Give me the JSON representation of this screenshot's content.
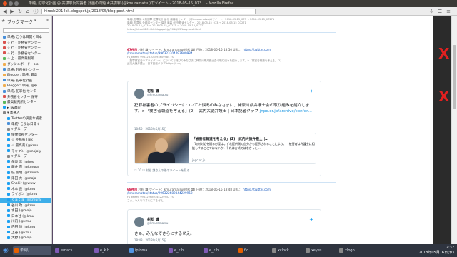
{
  "window": {
    "title": "単純\\ 犯罪化計画 @ 共謀罪反対論者 計画の問題 #共謀罪 (@kmuramatsu)のツイート - 2018-05-15_073… - Mozilla Firefox"
  },
  "nav": {
    "url": "hiroshi2014kk.blogspot.jp/2018/05/blog-post.html"
  },
  "sidebar": {
    "title": "ブックマーク",
    "items": [
      {
        "label": "単純\\ こうは日開く日本",
        "icon_color": "#4a90d9",
        "selected": false
      },
      {
        "label": "☆ 行 - 外務省センター",
        "icon_color": "#d9534f",
        "selected": false
      },
      {
        "label": "☆ 行 - 外務省センター",
        "icon_color": "#d9534f",
        "selected": false
      },
      {
        "label": "☆ 行 - 外務省センター",
        "icon_color": "#d9534f",
        "selected": false
      },
      {
        "label": "☆ 上 - 最高裁判所",
        "icon_color": "#5cb85c",
        "selected": false
      },
      {
        "label": "ダッシュボード - blo",
        "icon_color": "#f0ad4e",
        "selected": false
      },
      {
        "label": "単純\\ 外務省センター",
        "icon_color": "#4a90d9",
        "selected": false
      },
      {
        "label": "Blogger: 単純\\ 最高",
        "icon_color": "#f0ad4e",
        "selected": false
      },
      {
        "label": "単純\\ 犯罪化計画",
        "icon_color": "#4a90d9",
        "selected": false
      },
      {
        "label": "Blogger: 単純\\ 犯罪",
        "icon_color": "#f0ad4e",
        "selected": false
      },
      {
        "label": "単純\\ 犯罪化 センター",
        "icon_color": "#4a90d9",
        "selected": false
      },
      {
        "label": "外務省センター 保守",
        "icon_color": "#d9534f",
        "selected": false
      },
      {
        "label": "最高裁判所センター",
        "icon_color": "#5cb85c",
        "selected": false
      },
      {
        "label": "▸ Twitter",
        "icon_color": "#1da1f2",
        "selected": false
      },
      {
        "label": "▾ 本通人",
        "icon_color": "#888888",
        "selected": false
      },
      {
        "label": "Twitterの調査な検索",
        "icon_color": "#1da1f2",
        "selected": false
      },
      {
        "label": "単純\\ こうは日開く",
        "icon_color": "#4a90d9",
        "selected": false
      },
      {
        "label": "▾ グループ",
        "icon_color": "#888888",
        "selected": false
      },
      {
        "label": "保健福祉センター",
        "icon_color": "#1da1f2",
        "selected": false
      },
      {
        "label": "☆ 外務省 (@k",
        "icon_color": "#1da1f2",
        "selected": false
      },
      {
        "label": "☆ 最高裁 (@kmu",
        "icon_color": "#1da1f2",
        "selected": false
      },
      {
        "label": "モキケン (@mojoly",
        "icon_color": "#1da1f2",
        "selected": false
      },
      {
        "label": "▾ グループ",
        "icon_color": "#888888",
        "selected": false
      },
      {
        "label": "保坂 三 (@hos",
        "icon_color": "#1da1f2",
        "selected": false
      },
      {
        "label": "藤井 京 (@kmura",
        "icon_color": "#1da1f2",
        "selected": false
      },
      {
        "label": "低 聡明 (@kmura",
        "icon_color": "#1da1f2",
        "selected": false
      },
      {
        "label": "浮田 大 (@mojo",
        "icon_color": "#1da1f2",
        "selected": false
      },
      {
        "label": "Shokir (@www",
        "icon_color": "#1da1f2",
        "selected": false
      },
      {
        "label": "木本 良 (@kmu",
        "icon_color": "#1da1f2",
        "selected": false
      },
      {
        "label": "ライオン (@kmu",
        "icon_color": "#1da1f2",
        "selected": false
      },
      {
        "label": "くまくま (@kmura",
        "icon_color": "#1da1f2",
        "selected": true
      },
      {
        "label": "谷川 政 (@kmu",
        "icon_color": "#1da1f2",
        "selected": false
      },
      {
        "label": "水田 (@mojo",
        "icon_color": "#1da1f2",
        "selected": false
      },
      {
        "label": "日本社 (@kmu",
        "icon_color": "#1da1f2",
        "selected": false
      },
      {
        "label": "川内 (@kmu",
        "icon_color": "#1da1f2",
        "selected": false
      },
      {
        "label": "内田 悟 (@kmu",
        "icon_color": "#1da1f2",
        "selected": false
      },
      {
        "label": "上谷 (@kmu",
        "icon_color": "#1da1f2",
        "selected": false
      },
      {
        "label": "大野 (@mojo",
        "icon_color": "#1da1f2",
        "selected": false
      }
    ]
  },
  "content": {
    "top_lines": [
      "単純\\ 犯罪化 #共謀罪 犯罪化計画 @ 最高裁センター (@kmuramatsu)のツイート - 2018-05-15_073 → 2018-05-15_07271",
      "単純\\ 犯罪化 外務省センター 保守 最高 @ 外務省センター - 2018-05-15_073 → 2018-05-15_07271",
      "2018-05-15_073 → 2018-05-15_07271 → 2018-05-15_07271",
      "https://hiroshi2014kk.blogspot.jp/2018/05/blog-post.html"
    ],
    "entries": [
      {
        "number": "67件目",
        "head": "村松 謙 ツイート：kmuramatsu(村松 謙) 日時：2018-05-15 18:50 URL：",
        "link": "https://twitter.com",
        "link2": "/kmuramatsu/status/996323704493609984",
        "meta": [
          "Fs_tweet: 996323704493609984 FS",
          "〔犯罪被害者のプライバシー〕についてお詫びのみなさまに神奈川県弁護士会の取り組みを紹介します。>「被害者報道を考える」(2)",
          "武内大徳弁護士 | 日本記者クラブ https://t.co/..."
        ],
        "tweet": {
          "name": "村松 謙",
          "handle": "@kmuramatsu",
          "text": "犯罪被害者のプライバシーについてお悩みのみなさまに、神奈川県弁護士会の取り組みを紹介します。>「被害者報道を考える」(2)　武内大徳弁護士 | 日本記者クラブ",
          "url": "jnpc.or.jp/archive/confer…",
          "date": "18:50 - 2018年5月15日",
          "card_title": "「被害者報道を考える」(2)　武内大徳弁護士 |…",
          "card_desc": "「取材対応を通る必要はいずれ提供側の自分から提示されることにより、　被害者は弁護士に相談しすることではないか。それは方式ではなかった…",
          "card_domain": "jnpc.or.jp",
          "footer": "♡ 10   ☑ 村松 謙さんの他のツイートを見る"
        }
      },
      {
        "number": "68件目",
        "head": "村松 謙 ツイート：kmuramatsu(村松 謙) 日時：2018-05-15 18:48 URL：",
        "link": "https://twitter.com",
        "link2": "/kmuramatsu/status/996322689344229952",
        "meta": [
          "Fs_tweet: 996322689344229952 FS",
          "さぁ、みんなでさらにするぜえ。"
        ],
        "tweet": {
          "name": "村松 謙",
          "handle": "@kmuramatsu",
          "text": "さぁ、みんなでさらにするぜえ。",
          "date": "18:48 - 2018年5月15日"
        }
      }
    ]
  },
  "taskbar": {
    "items": [
      {
        "label": "単純\\",
        "icon_color": "#e66000"
      },
      {
        "label": "emacs",
        "icon_color": "#7f5ab6"
      },
      {
        "label": "e_k.h..",
        "icon_color": "#7f5ab6"
      },
      {
        "label": "ipfoma..",
        "icon_color": "#5294e2"
      },
      {
        "label": "e_k.h..",
        "icon_color": "#7f5ab6"
      },
      {
        "label": "e_k.h..",
        "icon_color": "#7f5ab6"
      },
      {
        "label": "flc",
        "icon_color": "#e66000"
      },
      {
        "label": "xclock",
        "icon_color": "#888888"
      },
      {
        "label": "xeyes",
        "icon_color": "#888888"
      },
      {
        "label": "xlogo",
        "icon_color": "#888888"
      }
    ],
    "time": "2:32",
    "date": "2018年05月16日(水)"
  },
  "colors": {
    "accent": "#3daee9",
    "twitter": "#1da1f2",
    "entry_number": "#cc0033"
  }
}
